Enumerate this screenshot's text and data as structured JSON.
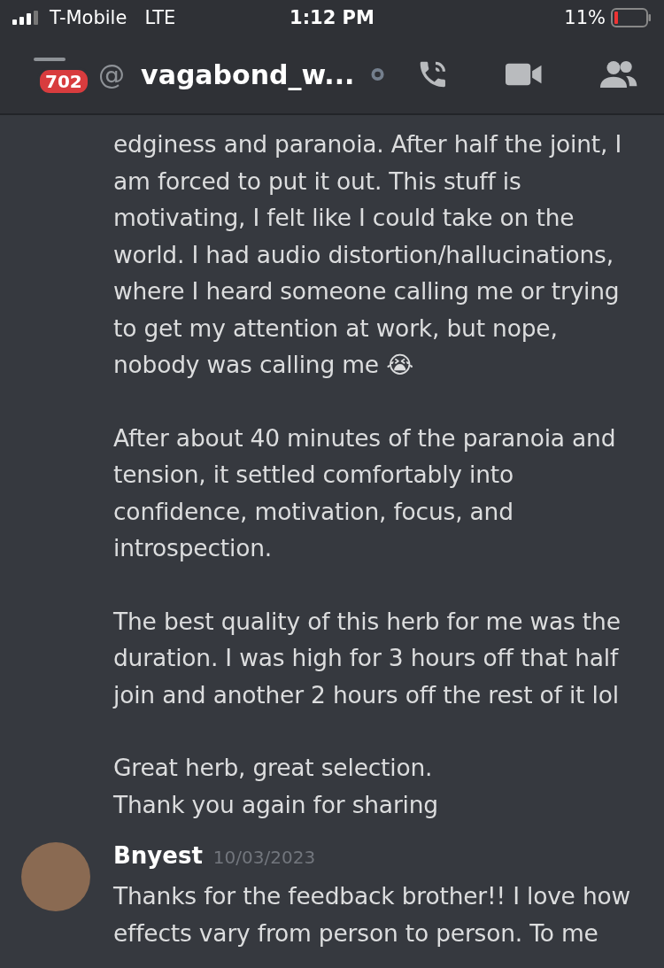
{
  "status_bar": {
    "carrier": "T-Mobile",
    "network": "LTE",
    "time": "1:12 PM",
    "battery": "11%"
  },
  "header": {
    "badge": "702",
    "at": "@",
    "title": "vagabond_w..."
  },
  "messages": [
    {
      "kind": "continuation",
      "paragraphs": [
        "edginess and paranoia. After half the joint, I am forced to put it out. This stuff is motivating, I felt like I could take on the world. I had audio distortion/hallucinations, where I heard someone calling me or trying to get my attention at work, but nope, nobody was calling me 😭",
        "After about 40 minutes of the paranoia and tension, it settled comfortably into confidence, motivation, focus, and introspection.",
        "The best quality of this herb for me was the duration. I was high for 3 hours off that half join and another 2 hours off the rest of it lol",
        "Great herb, great selection.\nThank you again for sharing"
      ]
    },
    {
      "kind": "full",
      "author": "Bnyest",
      "date": "10/03/2023",
      "paragraphs": [
        "Thanks for the feedback brother!! I love how effects vary from person to person. To me"
      ]
    }
  ]
}
